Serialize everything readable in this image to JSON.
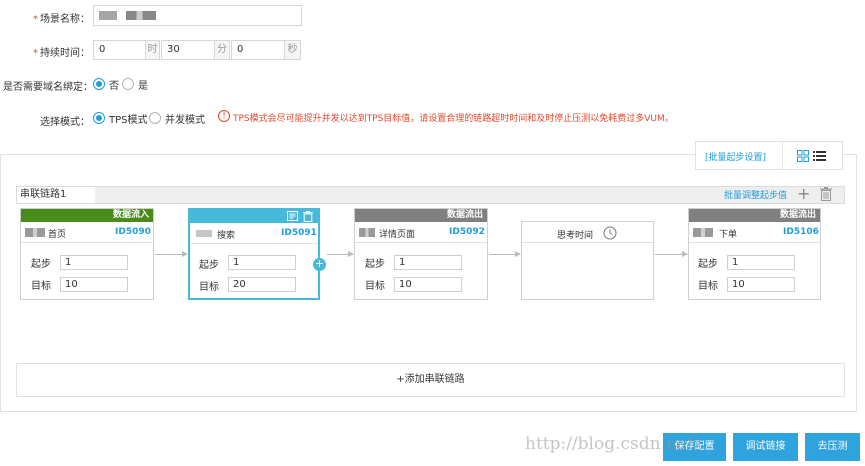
{
  "form": {
    "scene_name_label": "场景名称：",
    "duration_label": "持续时间：",
    "duration_hours": "0",
    "duration_hours_unit": "时",
    "duration_minutes": "30",
    "duration_minutes_unit": "分",
    "duration_seconds": "0",
    "duration_seconds_unit": "秒",
    "domain_bind_label": "是否需要域名绑定：",
    "domain_bind_no": "否",
    "domain_bind_yes": "是",
    "mode_label": "选择模式：",
    "mode_tps": "TPS模式",
    "mode_concurrent": "并发模式",
    "mode_warning": "TPS模式会尽可能提升并发以达到TPS目标值，请设置合理的链路超时时间和及时停止压测以免耗费过多VUM。"
  },
  "panel": {
    "batch_start_button": "[批量起步设置]",
    "chain_name": "串联链路1",
    "batch_adjust_link": "批量调整起步值",
    "add_chain": "+添加串联链路"
  },
  "nodes": [
    {
      "head": "数据流入",
      "title": "首页",
      "id": "ID5090",
      "start_label": "起步",
      "start": "1",
      "target_label": "目标",
      "target": "10"
    },
    {
      "head": "",
      "title": "搜索",
      "id": "ID5091",
      "start_label": "起步",
      "start": "1",
      "target_label": "目标",
      "target": "20"
    },
    {
      "head": "数据流出",
      "title": "详情页面",
      "id": "ID5092",
      "start_label": "起步",
      "start": "1",
      "target_label": "目标",
      "target": "10"
    },
    {
      "head": "",
      "title": "思考时间",
      "id": "",
      "start_label": "",
      "start": "",
      "target_label": "",
      "target": ""
    },
    {
      "head": "数据流出",
      "title": "下单",
      "id": "ID5106",
      "start_label": "起步",
      "start": "1",
      "target_label": "目标",
      "target": "10"
    }
  ],
  "footer": {
    "save_button": "保存配置",
    "debug_button": "调试链接",
    "run_button": "去压测",
    "watermark": "http://blog.csdn.net/"
  },
  "colors": {
    "accent": "#1f9ede",
    "inflow_head": "#4a8c1c",
    "outflow_head": "#808080",
    "selected_border": "#49b9d9",
    "warning": "#e5482d"
  }
}
